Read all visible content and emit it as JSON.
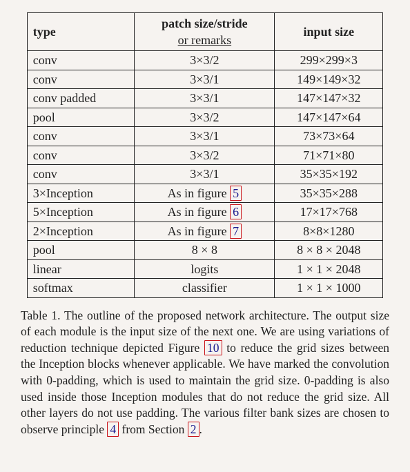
{
  "table": {
    "headers": {
      "type": "type",
      "patch": "patch size/stride",
      "patch_remark": "or remarks",
      "input": "input size"
    },
    "rows": [
      {
        "type": "conv",
        "patch": "3×3/2",
        "input": "299×299×3"
      },
      {
        "type": "conv",
        "patch": "3×3/1",
        "input": "149×149×32"
      },
      {
        "type": "conv padded",
        "patch": "3×3/1",
        "input": "147×147×32"
      },
      {
        "type": "pool",
        "patch": "3×3/2",
        "input": "147×147×64"
      },
      {
        "type": "conv",
        "patch": "3×3/1",
        "input": "73×73×64"
      },
      {
        "type": "conv",
        "patch": "3×3/2",
        "input": "71×71×80"
      },
      {
        "type": "conv",
        "patch": "3×3/1",
        "input": "35×35×192"
      },
      {
        "type": "3×Inception",
        "patch_pre": "As in figure ",
        "patch_ref": "5",
        "input": "35×35×288"
      },
      {
        "type": "5×Inception",
        "patch_pre": "As in figure ",
        "patch_ref": "6",
        "input": "17×17×768"
      },
      {
        "type": "2×Inception",
        "patch_pre": "As in figure ",
        "patch_ref": "7",
        "input": "8×8×1280"
      },
      {
        "type": "pool",
        "patch": "8 × 8",
        "input": "8 × 8 × 2048"
      },
      {
        "type": "linear",
        "patch": "logits",
        "input": "1 × 1 × 2048"
      },
      {
        "type": "softmax",
        "patch": "classifier",
        "input": "1 × 1 × 1000"
      }
    ]
  },
  "caption": {
    "lead": "Table 1.",
    "p1": " The outline of the proposed network architecture. The output size of each module is the input size of the next one. We are using variations of reduction technique depicted Figure ",
    "ref10": "10",
    "p2": " to reduce the grid sizes between the Inception blocks whenever applicable. We have marked the convolution with 0-padding, which is used to maintain the grid size. 0-padding is also used inside those Inception modules that do not reduce the grid size. All other layers do not use padding. The various filter bank sizes are chosen to observe principle ",
    "ref4": "4",
    "p3": " from Section ",
    "ref2": "2",
    "p4": "."
  }
}
